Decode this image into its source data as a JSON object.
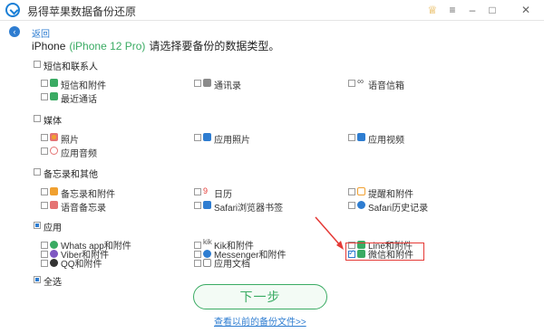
{
  "app": {
    "title": "易得苹果数据备份还原"
  },
  "nav": {
    "back_label": "返回"
  },
  "device": {
    "name": "iPhone",
    "model": "(iPhone 12 Pro)",
    "prompt": "请选择要备份的数据类型。"
  },
  "sections": [
    {
      "title": "短信和联系人",
      "items": [
        {
          "label": "短信和附件",
          "icon": "message-icon",
          "color": "#3aab63",
          "checked": false
        },
        {
          "label": "通讯录",
          "icon": "contacts-icon",
          "color": "#8a8a8a",
          "checked": false
        },
        {
          "label": "语音信箱",
          "icon": "voicemail-icon",
          "color": "#555555",
          "checked": false
        },
        {
          "label": "最近通话",
          "icon": "phone-icon",
          "color": "#3aab63",
          "checked": false
        }
      ]
    },
    {
      "title": "媒体",
      "items": [
        {
          "label": "照片",
          "icon": "photos-icon",
          "color": "#f0a030",
          "checked": false
        },
        {
          "label": "应用照片",
          "icon": "app-photos-icon",
          "color": "#2e7dd1",
          "checked": false
        },
        {
          "label": "应用视频",
          "icon": "app-videos-icon",
          "color": "#2e7dd1",
          "checked": false
        },
        {
          "label": "应用音频",
          "icon": "app-audio-icon",
          "color": "#e57373",
          "checked": false
        }
      ]
    },
    {
      "title": "备忘录和其他",
      "items": [
        {
          "label": "备忘录和附件",
          "icon": "notes-icon",
          "color": "#f0a030",
          "checked": false
        },
        {
          "label": "日历",
          "icon": "calendar-icon",
          "color": "#e53935",
          "checked": false
        },
        {
          "label": "提醒和附件",
          "icon": "reminders-icon",
          "color": "#f0a030",
          "checked": false
        },
        {
          "label": "语音备忘录",
          "icon": "voice-memo-icon",
          "color": "#e57373",
          "checked": false
        },
        {
          "label": "Safari浏览器书签",
          "icon": "safari-bookmark-icon",
          "color": "#2e7dd1",
          "checked": false
        },
        {
          "label": "Safari历史记录",
          "icon": "safari-history-icon",
          "color": "#2e7dd1",
          "checked": false
        }
      ]
    },
    {
      "title": "应用",
      "items": [
        {
          "label": "Whats app和附件",
          "icon": "whatsapp-icon",
          "color": "#3aab63",
          "checked": false
        },
        {
          "label": "Kik和附件",
          "icon": "kik-icon",
          "color": "#555555",
          "checked": false
        },
        {
          "label": "Line和附件",
          "icon": "line-icon",
          "color": "#3aab63",
          "checked": false
        },
        {
          "label": "Viber和附件",
          "icon": "viber-icon",
          "color": "#7e57c2",
          "checked": false
        },
        {
          "label": "Messenger和附件",
          "icon": "messenger-icon",
          "color": "#2e7dd1",
          "checked": false
        },
        {
          "label": "微信和附件",
          "icon": "wechat-icon",
          "color": "#3aab63",
          "checked": true
        },
        {
          "label": "QQ和附件",
          "icon": "qq-icon",
          "color": "#333333",
          "checked": false
        },
        {
          "label": "应用文档",
          "icon": "app-docs-icon",
          "color": "#8a8a8a",
          "checked": false
        }
      ]
    }
  ],
  "select_all_label": "全选",
  "next_button": "下一步",
  "view_previous_link": "查看以前的备份文件>>"
}
